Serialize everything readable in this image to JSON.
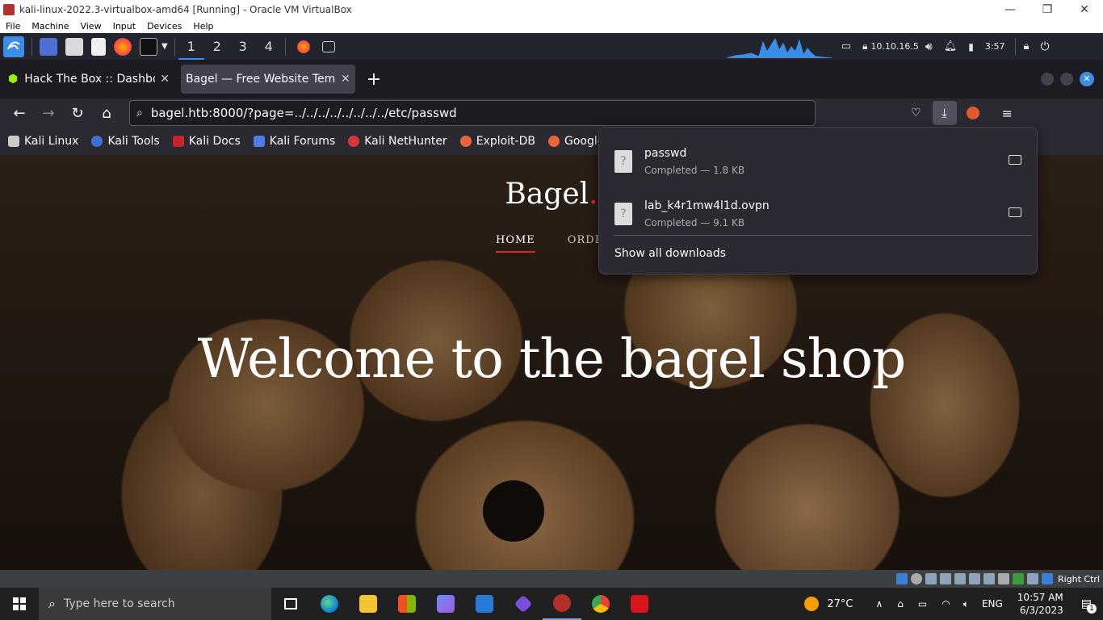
{
  "vm_window": {
    "title": "kali-linux-2022.3-virtualbox-amd64 [Running] - Oracle VM VirtualBox",
    "minimize": "—",
    "maximize": "❐",
    "close": "✕"
  },
  "vm_menu": [
    "File",
    "Machine",
    "View",
    "Input",
    "Devices",
    "Help"
  ],
  "kali_panel": {
    "workspaces": [
      "1",
      "2",
      "3",
      "4"
    ],
    "ip": "10.10.16.5",
    "clock": "3:57"
  },
  "browser": {
    "tabs": [
      {
        "title": "Hack The Box :: Dashboard",
        "active": false
      },
      {
        "title": "Bagel — Free Website Template",
        "active": true
      }
    ],
    "new_tab": "+",
    "url": "bagel.htb:8000/?page=../../../../../../../../etc/passwd",
    "bookmarks": [
      "Kali Linux",
      "Kali Tools",
      "Kali Docs",
      "Kali Forums",
      "Kali NetHunter",
      "Exploit-DB",
      "Google Hacki"
    ]
  },
  "page": {
    "brand": "Bagel",
    "brand_dot": ".",
    "nav": [
      "HOME",
      "ORDER"
    ],
    "heading": "Welcome to the bagel shop"
  },
  "downloads": {
    "items": [
      {
        "name": "passwd",
        "status": "Completed — 1.8 KB"
      },
      {
        "name": "lab_k4r1mw4l1d.ovpn",
        "status": "Completed — 9.1 KB"
      }
    ],
    "show_all": "Show all downloads"
  },
  "vb_status": {
    "host_key": "Right Ctrl"
  },
  "taskbar": {
    "search_placeholder": "Type here to search",
    "weather": "27°C",
    "language": "ENG",
    "time": "10:57 AM",
    "date": "6/3/2023",
    "notifications": "1"
  },
  "colors": {
    "accent_red": "#e0242a",
    "firefox_bg": "#2b2a33",
    "kali_blue": "#3b8ee8"
  }
}
